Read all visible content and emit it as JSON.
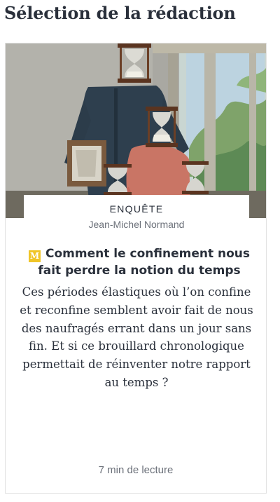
{
  "section": {
    "title": "Sélection de la rédaction"
  },
  "article": {
    "image_alt": "Collage: figures with hourglass heads in a vintage garden room",
    "kicker": "ENQUÊTE",
    "author": "Jean-Michel Normand",
    "premium_badge": "M",
    "headline": "Comment le confinement nous fait perdre la notion du temps",
    "description": "Ces périodes élastiques où l’on confine et reconfine semblent avoir fait de nous des naufragés errant dans un jour sans fin. Et si ce brouillard chronologique permettait de réinventer notre rapport au temps ?",
    "read_time": "7 min de lecture"
  },
  "colors": {
    "text": "#2a303b",
    "muted": "#6b7079",
    "badge": "#f0c528",
    "border": "#e2e2e2"
  }
}
